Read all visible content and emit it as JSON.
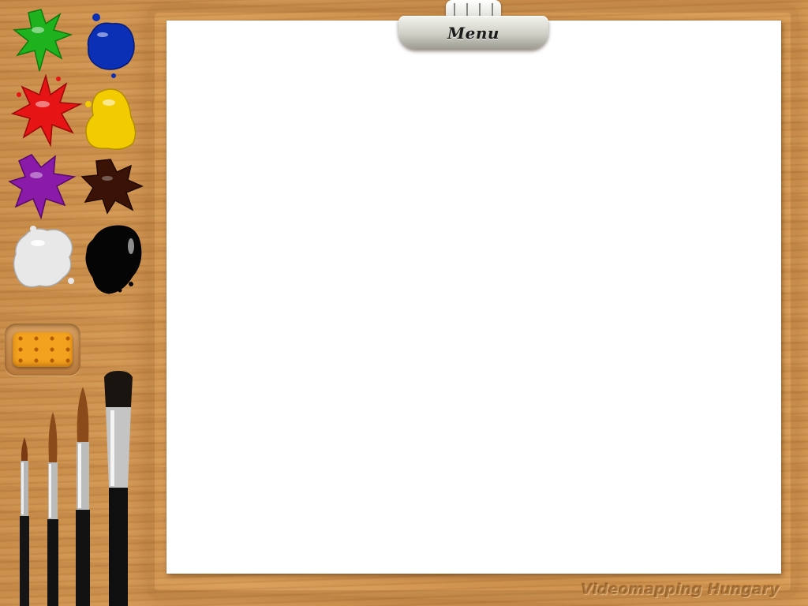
{
  "app": {
    "menu_label": "Menu",
    "watermark": "Videomapping Hungary"
  },
  "palette": [
    {
      "name": "green",
      "color": "#1fb21f"
    },
    {
      "name": "blue",
      "color": "#0b2fb5"
    },
    {
      "name": "red",
      "color": "#e61414"
    },
    {
      "name": "yellow",
      "color": "#f2cc00"
    },
    {
      "name": "purple",
      "color": "#8a1aa8"
    },
    {
      "name": "brown",
      "color": "#3a1306"
    },
    {
      "name": "white",
      "color": "#e8e8e8"
    },
    {
      "name": "black",
      "color": "#050505"
    }
  ],
  "tools": {
    "sponge": "sponge-eraser",
    "brushes": [
      "brush-fine",
      "brush-small",
      "brush-medium",
      "brush-flat-large"
    ]
  }
}
